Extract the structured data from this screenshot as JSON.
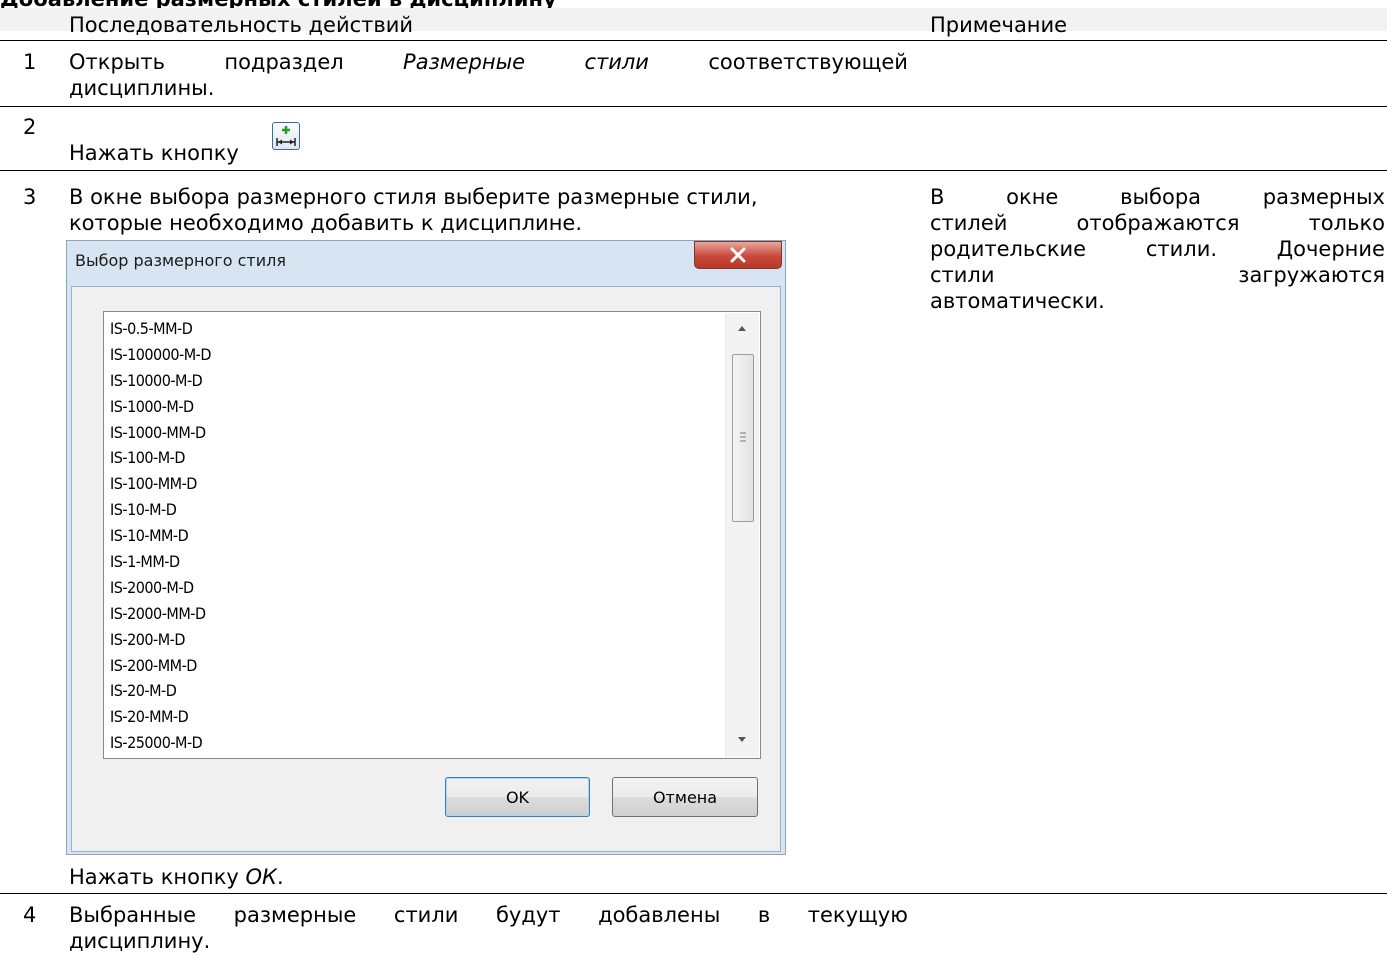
{
  "heading": "Добавление размерных стилей в дисциплину",
  "table": {
    "col_actions": "Последовательность действий",
    "col_notes": "Примечание",
    "rows": [
      {
        "num": "1",
        "line1_words": [
          "Открыть",
          "подраздел",
          "Размерные",
          "стили",
          "соответствующей"
        ],
        "line2": "дисциплины."
      },
      {
        "num": "2",
        "text": "Нажать кнопку",
        "button_icon": "add-dimension-style-icon"
      },
      {
        "num": "3",
        "line1": "В окне выбора размерного стиля выберите размерные стили,",
        "line2": "которые необходимо добавить к дисциплине.",
        "after": "Нажать кнопку ",
        "after_em": "ОК",
        "after_end": ".",
        "note_line1_words": [
          "В",
          "окне",
          "выбора",
          "размерных"
        ],
        "note_line2_words": [
          "стилей",
          "отображаются",
          "только"
        ],
        "note_line3_words": [
          "родительские",
          "стили.",
          "Дочерние"
        ],
        "note_line4_words": [
          "стили",
          "загружаются"
        ],
        "note_line5": "автоматически."
      },
      {
        "num": "4",
        "line1_words": [
          "Выбранные",
          "размерные",
          "стили",
          "будут",
          "добавлены",
          "в",
          "текущую"
        ],
        "line2": "дисциплину."
      }
    ]
  },
  "dialog": {
    "title": "Выбор размерного стиля",
    "items": [
      "IS-0.5-MM-D",
      "IS-100000-M-D",
      "IS-10000-M-D",
      "IS-1000-M-D",
      "IS-1000-MM-D",
      "IS-100-M-D",
      "IS-100-MM-D",
      "IS-10-M-D",
      "IS-10-MM-D",
      "IS-1-MM-D",
      "IS-2000-M-D",
      "IS-2000-MM-D",
      "IS-200-M-D",
      "IS-200-MM-D",
      "IS-20-M-D",
      "IS-20-MM-D",
      "IS-25000-M-D"
    ],
    "ok_label": "OK",
    "cancel_label": "Отмена"
  }
}
